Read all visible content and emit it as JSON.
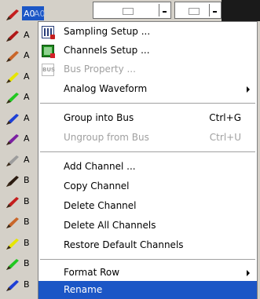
{
  "channel_list": {
    "rows": [
      {
        "label": "A0",
        "label_ghost": "A0",
        "pen_color": "#c41e1e",
        "selected": true
      },
      {
        "label": "A",
        "pen_color": "#b01818"
      },
      {
        "label": "A",
        "pen_color": "#c9662a"
      },
      {
        "label": "A",
        "pen_color": "#e6e600"
      },
      {
        "label": "A",
        "pen_color": "#21c721"
      },
      {
        "label": "A",
        "pen_color": "#1d3fd6"
      },
      {
        "label": "A",
        "pen_color": "#7a1fa2"
      },
      {
        "label": "A",
        "pen_color": "#9c9c9c"
      },
      {
        "label": "B",
        "pen_color": "#2a1a10"
      },
      {
        "label": "B",
        "pen_color": "#c41e1e"
      },
      {
        "label": "B",
        "pen_color": "#c9662a"
      },
      {
        "label": "B",
        "pen_color": "#e6e600"
      },
      {
        "label": "B",
        "pen_color": "#21c721"
      },
      {
        "label": "B",
        "pen_color": "#1d3fd6"
      }
    ]
  },
  "context_menu": {
    "items": [
      {
        "label": "Sampling Setup ...",
        "icon": "sampling-setup-icon",
        "enabled": true
      },
      {
        "label": "Channels Setup ...",
        "icon": "channels-setup-icon",
        "enabled": true
      },
      {
        "label": "Bus Property ...",
        "icon": "bus-property-icon",
        "icon_text": "BUS",
        "enabled": false
      },
      {
        "label": "Analog Waveform",
        "submenu": true,
        "enabled": true
      },
      {
        "label": "Group into Bus",
        "shortcut": "Ctrl+G",
        "enabled": true
      },
      {
        "label": "Ungroup from Bus",
        "shortcut": "Ctrl+U",
        "enabled": false
      },
      {
        "label": "Add Channel ...",
        "enabled": true
      },
      {
        "label": "Copy Channel",
        "enabled": true
      },
      {
        "label": "Delete Channel",
        "enabled": true
      },
      {
        "label": "Delete All Channels",
        "enabled": true
      },
      {
        "label": "Restore Default Channels",
        "enabled": true
      },
      {
        "label": "Format Row",
        "submenu": true,
        "enabled": true
      },
      {
        "label": "Rename",
        "enabled": true,
        "highlighted": true
      }
    ]
  },
  "colors": {
    "highlight": "#1b56c6",
    "disabled_text": "#a0a0a0",
    "window_bg": "#d4d0c8"
  }
}
